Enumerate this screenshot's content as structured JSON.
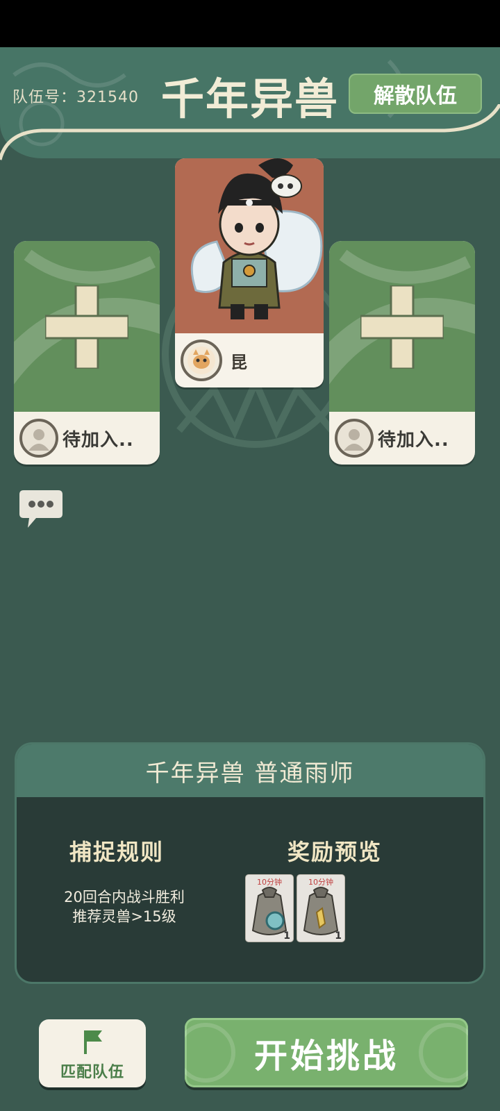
{
  "header": {
    "team_label": "队伍号：",
    "team_id": "321540",
    "title": "千年异兽",
    "disband_label": "解散队伍"
  },
  "slots": {
    "left_label": "待加入..",
    "right_label": "待加入.."
  },
  "hero": {
    "name": "昆"
  },
  "panel": {
    "title": "千年异兽  普通雨师",
    "rules_title": "捕捉规则",
    "rules": [
      "20回合内战斗胜利",
      "推荐灵兽>15级"
    ],
    "rewards_title": "奖励预览",
    "rewards": [
      {
        "time": "10分钟",
        "count": "1"
      },
      {
        "time": "10分钟",
        "count": "1"
      }
    ]
  },
  "buttons": {
    "match_label": "匹配队伍",
    "start_label": "开始挑战"
  },
  "colors": {
    "background": "#3b5a50",
    "header": "#477566",
    "accent_green": "#79b16e",
    "card_art_green": "#628f5c",
    "hero_art_red": "#b26a52"
  }
}
